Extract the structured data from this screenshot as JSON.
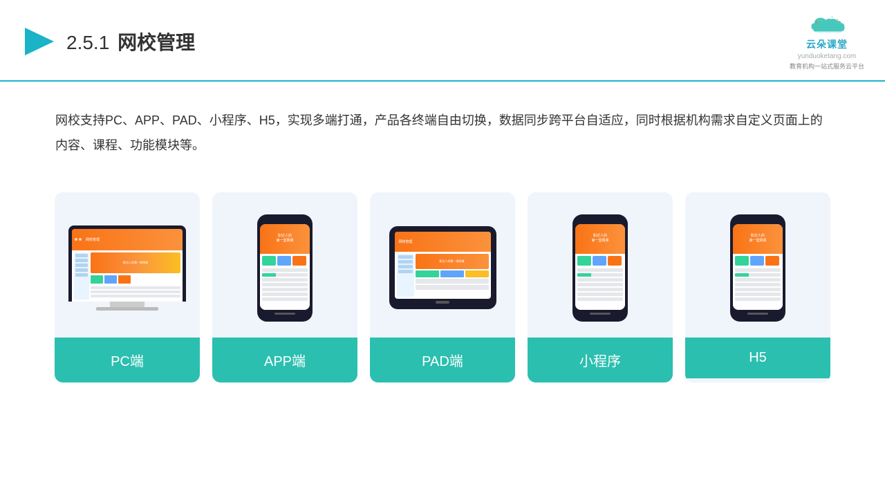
{
  "header": {
    "title_prefix": "2.5.1",
    "title_main": "网校管理",
    "logo_name": "云朵课堂",
    "logo_url": "yunduoketang.com",
    "logo_sub1": "教育机构一站",
    "logo_sub2": "式服务云平台"
  },
  "description": {
    "text": "网校支持PC、APP、PAD、小程序、H5，实现多端打通，产品各终端自由切换，数据同步跨平台自适应，同时根据机构需求自定义页面上的内容、课程、功能模块等。"
  },
  "cards": [
    {
      "id": "pc",
      "label": "PC端"
    },
    {
      "id": "app",
      "label": "APP端"
    },
    {
      "id": "pad",
      "label": "PAD端"
    },
    {
      "id": "miniapp",
      "label": "小程序"
    },
    {
      "id": "h5",
      "label": "H5"
    }
  ],
  "accent_color": "#2bbfb0"
}
